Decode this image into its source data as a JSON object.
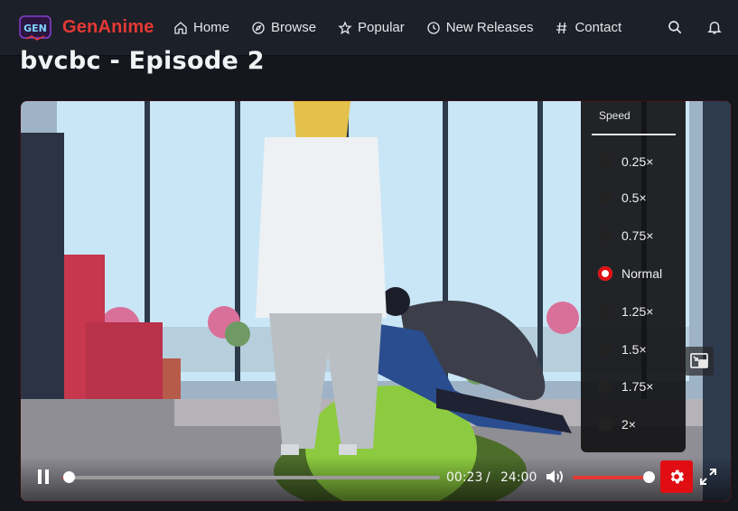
{
  "brand": {
    "name": "GenAnime",
    "logo_text": "GEN"
  },
  "nav": {
    "items": [
      {
        "label": "Home",
        "icon": "home-icon"
      },
      {
        "label": "Browse",
        "icon": "compass-icon"
      },
      {
        "label": "Popular",
        "icon": "star-icon"
      },
      {
        "label": "New Releases",
        "icon": "clock-icon"
      },
      {
        "label": "Contact",
        "icon": "hash-icon"
      }
    ],
    "right_icons": [
      "search-icon",
      "bell-icon"
    ]
  },
  "page": {
    "title": "bvcbc - Episode 2"
  },
  "player": {
    "current_time": "00:23",
    "separator": "/",
    "duration": "24:00",
    "progress_fraction": 0.016,
    "volume_fraction": 1.0,
    "speed_menu": {
      "title": "Speed",
      "options": [
        "0.25×",
        "0.5×",
        "0.75×",
        "Normal",
        "1.25×",
        "1.5×",
        "1.75×",
        "2×"
      ],
      "selected": "Normal"
    }
  },
  "colors": {
    "accent": "#e53935",
    "nav_bg": "#1c2028",
    "page_bg": "#14171d"
  }
}
